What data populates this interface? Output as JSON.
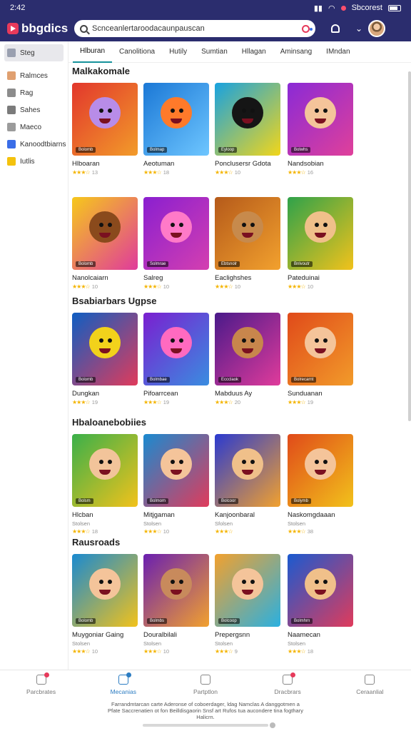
{
  "status": {
    "time": "2:42",
    "carrier": "Sbcorest"
  },
  "app": {
    "logo": "bbgdics"
  },
  "search": {
    "value": "Scnceanlertaroodacaunpauscan",
    "placeholder": ""
  },
  "sidebar": {
    "items": [
      {
        "label": "Steg",
        "icon": "home-icon",
        "color": "#9aa0b0"
      },
      {
        "label": "Ralmces",
        "icon": "profile-icon",
        "color": "#e0a070"
      },
      {
        "label": "Rag",
        "icon": "people-icon",
        "color": "#8c8c8c"
      },
      {
        "label": "Sahes",
        "icon": "book-icon",
        "color": "#7b7b7b"
      },
      {
        "label": "Maeco",
        "icon": "users-icon",
        "color": "#9b9b9b"
      },
      {
        "label": "Kanoodtbiarns",
        "icon": "shapes-icon",
        "color": "#3a6de7"
      },
      {
        "label": "Iutlis",
        "icon": "lightning-icon",
        "color": "#f4c20d"
      }
    ]
  },
  "tabs": [
    "Hlburan",
    "Canolitiona",
    "Hutily",
    "Sumtian",
    "Hllagan",
    "Aminsang",
    "IMndan"
  ],
  "sections": [
    {
      "title": "Malkakomale",
      "rows": [
        [
          {
            "title": "Hlboaran",
            "sub": "",
            "rating": "13",
            "badge": "Bolomb",
            "bg": "linear-gradient(135deg,#e2372c,#f29b2a)",
            "face": "#b88ce8"
          },
          {
            "title": "Aeotuman",
            "sub": "",
            "rating": "18",
            "badge": "Bolmap",
            "bg": "linear-gradient(135deg,#1b78d6,#6ec6ff)",
            "face": "#ff7a2a"
          },
          {
            "title": "Ponclusersr Gdota",
            "sub": "",
            "rating": "10",
            "badge": "Eyloop",
            "bg": "linear-gradient(135deg,#18a2e0,#f2d61a)",
            "face": "#151515"
          },
          {
            "title": "Nandsobian",
            "sub": "",
            "rating": "16",
            "badge": "Bolwhs",
            "bg": "linear-gradient(135deg,#8a2ad6,#e0409a)",
            "face": "#f4c49a"
          }
        ],
        [
          {
            "title": "Nanolcaiarn",
            "sub": "",
            "rating": "10",
            "badge": "Bolomb",
            "bg": "linear-gradient(135deg,#f6c81b,#e03b9b)",
            "face": "#8a4a1c"
          },
          {
            "title": "Salreg",
            "sub": "",
            "rating": "10",
            "badge": "Solmrae",
            "bg": "linear-gradient(135deg,#8a1fd0,#d43fb0)",
            "face": "#ff7ac8"
          },
          {
            "title": "Eaclighshes",
            "sub": "",
            "rating": "10",
            "badge": "Ebtsnolr",
            "bg": "linear-gradient(135deg,#b55a1a,#f2a12e)",
            "face": "#c78a4c"
          },
          {
            "title": "Pateduinai",
            "sub": "",
            "rating": "10",
            "badge": "Bnlvoutr",
            "bg": "linear-gradient(135deg,#2fa24a,#f2c21b)",
            "face": "#f0c08a"
          }
        ]
      ]
    },
    {
      "title": "Bsabiarbars Ugpse",
      "rows": [
        [
          {
            "title": "Dungkan",
            "sub": "",
            "rating": "19",
            "badge": "Bolomb",
            "bg": "linear-gradient(135deg,#0f5ec2,#e03b5b)",
            "face": "#f2d21b"
          },
          {
            "title": "Pifoarrcean",
            "sub": "",
            "rating": "19",
            "badge": "Bolmbae",
            "bg": "linear-gradient(135deg,#7a1fd0,#3a8de0)",
            "face": "#ff6ac0"
          },
          {
            "title": "Mabduus Ay",
            "sub": "",
            "rating": "20",
            "badge": "Eccclaok",
            "bg": "linear-gradient(135deg,#4a1a8a,#e03b9b)",
            "face": "#c8864c"
          },
          {
            "title": "Sunduanan",
            "sub": "",
            "rating": "19",
            "badge": "Bolrecarnt",
            "bg": "linear-gradient(135deg,#e04a1a,#f29b2a)",
            "face": "#f4c49a"
          }
        ]
      ]
    },
    {
      "title": "Hbaloanebobiies",
      "rows": [
        [
          {
            "title": "Hlcban",
            "sub": "Stolsen",
            "rating": "18",
            "badge": "Bolsm",
            "bg": "linear-gradient(135deg,#3ab04a,#f2c21b)",
            "face": "#f2c49a"
          },
          {
            "title": "Mitjgaman",
            "sub": "Stolsen",
            "rating": "10",
            "badge": "Bolmom",
            "bg": "linear-gradient(135deg,#1a8ad0,#e03b5b)",
            "face": "#f4c49a"
          },
          {
            "title": "Kanjoonbaral",
            "sub": "Sfolsen",
            "rating": "",
            "badge": "Bolcoor",
            "bg": "linear-gradient(135deg,#2a3ad0,#f2a12e)",
            "face": "#f0c08a"
          },
          {
            "title": "Naskomgdaaan",
            "sub": "Stolsen",
            "rating": "38",
            "badge": "Bolymb",
            "bg": "linear-gradient(135deg,#e04a1a,#f2c21b)",
            "face": "#f4c49a"
          }
        ]
      ]
    },
    {
      "title": "Rausroads",
      "rows": [
        [
          {
            "title": "Muygoniar Gaing",
            "sub": "Stolsen",
            "rating": "10",
            "badge": "Bolomb",
            "bg": "linear-gradient(135deg,#1a8ad0,#f2c21b)",
            "face": "#f4c49a"
          },
          {
            "title": "Douralbilali",
            "sub": "Stolsen",
            "rating": "10",
            "badge": "Bolmbs",
            "bg": "linear-gradient(135deg,#6a1fb0,#f2a12e)",
            "face": "#c88a5c"
          },
          {
            "title": "Prepergsnn",
            "sub": "Stolsen",
            "rating": "9",
            "badge": "Bolcoop",
            "bg": "linear-gradient(135deg,#f2a12e,#2ab0e0)",
            "face": "#f4c49a"
          },
          {
            "title": "Naamecan",
            "sub": "Stolsen",
            "rating": "18",
            "badge": "Bolmhrn",
            "bg": "linear-gradient(135deg,#1a5ad0,#e03b5b)",
            "face": "#f0c08a"
          }
        ]
      ]
    }
  ],
  "bottomnav": {
    "items": [
      {
        "label": "Parcbrates",
        "icon": "home-icon",
        "dot": "red"
      },
      {
        "label": "Mecanias",
        "icon": "grid-icon",
        "dot": "blue"
      },
      {
        "label": "Partptlon",
        "icon": "bag-icon",
        "dot": ""
      },
      {
        "label": "Dracbrars",
        "icon": "chat-icon",
        "dot": "red"
      },
      {
        "label": "Ceraanlial",
        "icon": "account-icon",
        "dot": ""
      }
    ],
    "footer": "Farrandmtarcan carte Aderonse of coboerdager, ldag Namclas A danggotmen a Pfate Saccrenatien ot fon Beilldisgaorin Snsf art Rufos tua aucondere tina fogthary Halicrn."
  },
  "colors": {
    "header": "#2b2d6e",
    "accent": "#16929b",
    "brand": "#e73a5b"
  }
}
